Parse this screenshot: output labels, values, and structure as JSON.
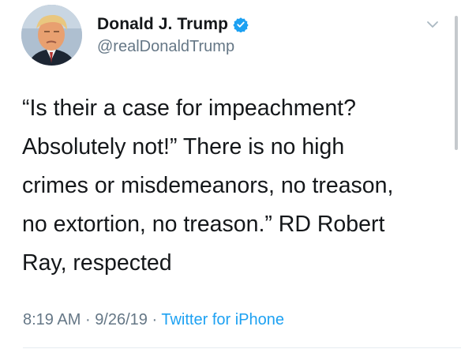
{
  "author": {
    "display_name": "Donald J. Trump",
    "handle": "@realDonaldTrump",
    "verified": true,
    "avatar_icon": "profile-photo"
  },
  "tweet": {
    "text": "“Is their a case for impeachment?\nAbsolutely not!” There is no high\ncrimes or misdemeanors, no treason,\nno extortion, no treason.” RD Robert\nRay, respected",
    "time": "8:19 AM",
    "date": "9/26/19",
    "separator": "·",
    "source": "Twitter for iPhone"
  },
  "colors": {
    "text": "#14171a",
    "secondary": "#657786",
    "link": "#1da1f2",
    "verified_badge": "#1da1f2"
  },
  "icons": {
    "verified": "verified-badge-icon",
    "more": "chevron-down-icon"
  }
}
